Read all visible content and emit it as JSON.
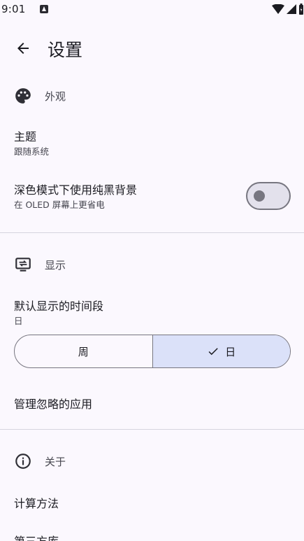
{
  "status_bar": {
    "time": "9:01"
  },
  "app_bar": {
    "title": "设置"
  },
  "sections": {
    "appearance": {
      "title": "外观"
    },
    "display": {
      "title": "显示"
    },
    "about": {
      "title": "关于"
    }
  },
  "appearance": {
    "theme": {
      "title": "主题",
      "value": "跟随系统"
    },
    "pure_black": {
      "title": "深色模式下使用纯黑背景",
      "subtitle": "在 OLED 屏幕上更省电",
      "enabled": false
    }
  },
  "display": {
    "default_period": {
      "title": "默认显示的时间段",
      "value": "日"
    },
    "period_options": {
      "week": "周",
      "day": "日",
      "selected": "日"
    },
    "ignored_apps": {
      "title": "管理忽略的应用"
    }
  },
  "about": {
    "calculation": {
      "title": "计算方法"
    },
    "third_party": {
      "title": "第三方库"
    }
  },
  "icons": {
    "back": "arrow-left-icon",
    "appearance": "palette-icon",
    "display": "display-icon",
    "about": "info-icon",
    "check": "check-icon"
  },
  "colors": {
    "background": "#fbf8fe",
    "selected_segment": "#dbe1f9",
    "outline": "#777680"
  }
}
